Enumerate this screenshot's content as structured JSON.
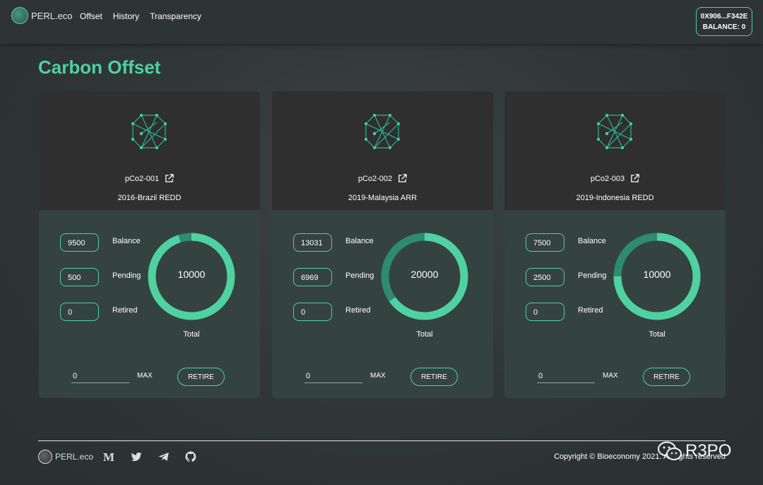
{
  "header": {
    "brand": "PERL.eco",
    "nav": [
      "Offset",
      "History",
      "Transparency"
    ],
    "wallet_address": "0X906...F342E",
    "wallet_balance": "BALANCE: 0"
  },
  "page_title": "Carbon Offset",
  "cards": [
    {
      "id": "pCo2-001",
      "name": "2016-Brazil REDD",
      "balance": "9500",
      "pending": "500",
      "retired": "0",
      "total": "10000",
      "input_value": "0",
      "balance_fraction": 0.95
    },
    {
      "id": "pCo2-002",
      "name": "2019-Malaysia ARR",
      "balance": "13031",
      "pending": "6969",
      "retired": "0",
      "total": "20000",
      "input_value": "0",
      "balance_fraction": 0.65155
    },
    {
      "id": "pCo2-003",
      "name": "2019-Indonesia REDD",
      "balance": "7500",
      "pending": "2500",
      "retired": "0",
      "total": "10000",
      "input_value": "0",
      "balance_fraction": 0.75
    }
  ],
  "labels": {
    "balance": "Balance",
    "pending": "Pending",
    "retired": "Retired",
    "total": "Total",
    "max": "MAX",
    "retire": "RETIRE"
  },
  "colors": {
    "accent": "#4fd1a0",
    "ring_bg": "#2e8a73"
  },
  "footer": {
    "brand": "PERL.eco",
    "social": [
      "medium-icon",
      "twitter-icon",
      "telegram-icon",
      "github-icon"
    ],
    "copyright": "Copyright © Bioeconomy 2021. All rights reserved",
    "watermark": "R3PO"
  }
}
